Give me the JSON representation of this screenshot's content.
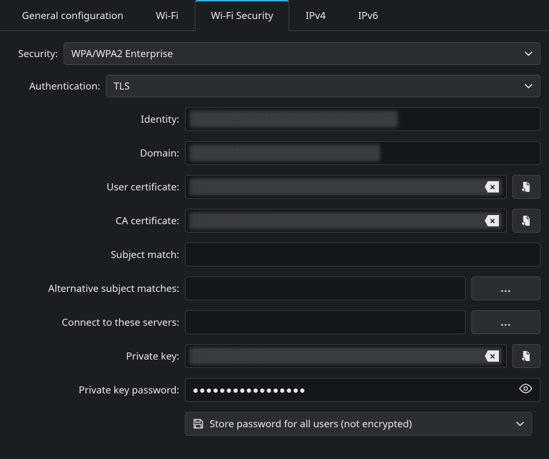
{
  "tabs": {
    "general": "General configuration",
    "wifi": "Wi-Fi",
    "wifi_security": "Wi-Fi Security",
    "ipv4": "IPv4",
    "ipv6": "IPv6"
  },
  "labels": {
    "security": "Security:",
    "authentication": "Authentication:",
    "identity": "Identity:",
    "domain": "Domain:",
    "user_certificate": "User certificate:",
    "ca_certificate": "CA certificate:",
    "subject_match": "Subject match:",
    "alt_subject_matches": "Alternative subject matches:",
    "connect_servers": "Connect to these servers:",
    "private_key": "Private key:",
    "private_key_password": "Private key password:"
  },
  "values": {
    "security": "WPA/WPA2 Enterprise",
    "authentication": "TLS",
    "identity": "",
    "domain": "",
    "user_certificate": "",
    "ca_certificate": "",
    "subject_match": "",
    "alt_subject_matches": "",
    "connect_servers": "",
    "private_key": "",
    "private_key_password": "●●●●●●●●●●●●●●●●●",
    "ellipsis": "...",
    "store_password": "Store password for all users (not encrypted)"
  }
}
